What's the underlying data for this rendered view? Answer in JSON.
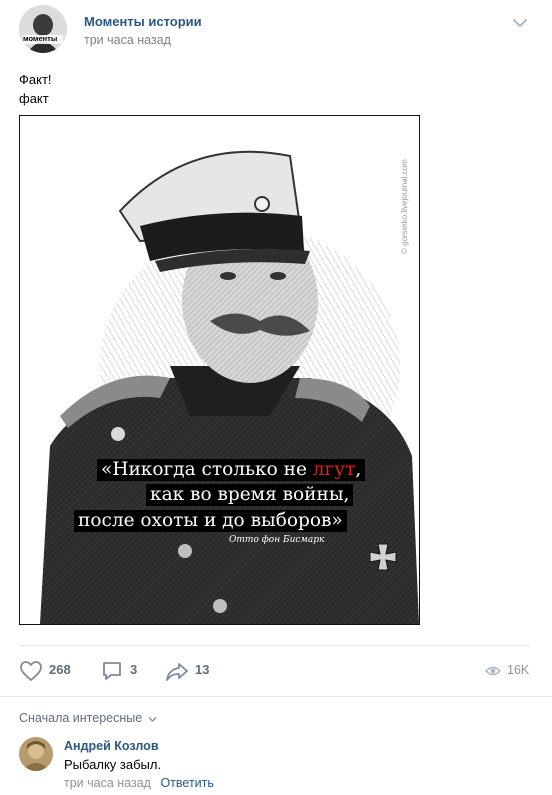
{
  "post": {
    "group_name": "Моменты истории",
    "avatar_caption": "моменты",
    "time": "три часа назад",
    "text_line1": "Факт!",
    "text_line2": "факт"
  },
  "image": {
    "quote_part1": "«Никогда столько не ",
    "quote_highlight": "лгут",
    "quote_part1_end": ",",
    "quote_line2": "как во время войны,",
    "quote_line3": "после охоты и до выборов»",
    "signature": "Отто фон Бисмарк",
    "watermark": "© gorserko.livejournal.com",
    "highlight_color": "#e0201c"
  },
  "actions": {
    "likes": "268",
    "comments": "3",
    "shares": "13",
    "views": "16K"
  },
  "comments": {
    "sort_label": "Сначала интересные",
    "items": [
      {
        "author": "Андрей Козлов",
        "text": "Рыбалку забыл.",
        "time": "три часа назад",
        "reply_label": "Ответить"
      }
    ]
  },
  "colors": {
    "link": "#2a5885",
    "muted": "#828282",
    "icon": "#828a99"
  }
}
